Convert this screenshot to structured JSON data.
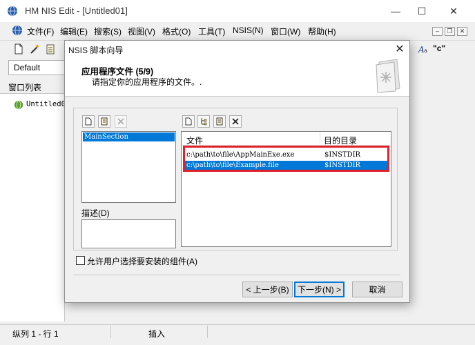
{
  "window": {
    "title": "HM NIS Edit - [Untitled01]",
    "minimize_glyph": "—",
    "maximize_glyph": "☐",
    "close_glyph": "✕"
  },
  "menu": [
    {
      "label": "文件(F)"
    },
    {
      "label": "编辑(E)"
    },
    {
      "label": "搜索(S)"
    },
    {
      "label": "视图(V)"
    },
    {
      "label": "格式(O)"
    },
    {
      "label": "工具(T)"
    },
    {
      "label": "NSIS(N)"
    },
    {
      "label": "窗口(W)"
    },
    {
      "label": "帮助(H)"
    }
  ],
  "toolbar": {
    "dropdown_value": "Default",
    "right_text": "\"c\""
  },
  "left_panel": {
    "title": "窗口列表",
    "item": "Untitled01"
  },
  "status": {
    "position": "纵列 1 - 行 1",
    "mode": "插入"
  },
  "dialog": {
    "title": "NSIS 脚本向导",
    "close_glyph": "✕",
    "heading": "应用程序文件 (5/9)",
    "subheading": "请指定你的应用程序的文件。.",
    "section_item": "MainSection",
    "description_label": "描述(D)",
    "columns": {
      "file": "文件",
      "dest": "目的目录"
    },
    "rows": [
      {
        "file": "c:\\path\\to\\file\\AppMainExe.exe",
        "dest": "$INSTDIR"
      },
      {
        "file": "c:\\path\\to\\file\\Example.file",
        "dest": "$INSTDIR"
      }
    ],
    "checkbox_label": "允许用户选择要安装的组件(A)",
    "buttons": {
      "back": "< 上一步(B)",
      "next": "下一步(N) >",
      "cancel": "取消"
    }
  },
  "colors": {
    "selection": "#0078d7",
    "highlight": "#e0202a"
  }
}
